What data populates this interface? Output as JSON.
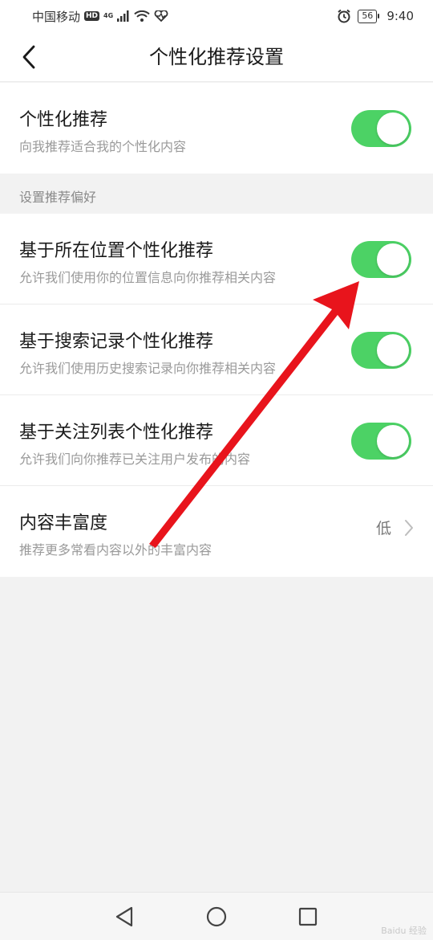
{
  "status_bar": {
    "carrier": "中国移动",
    "hd": "HD",
    "network": "4G",
    "battery": "56",
    "time": "9:40"
  },
  "header": {
    "title": "个性化推荐设置",
    "back_icon": "chevron-left-icon"
  },
  "main_setting": {
    "title": "个性化推荐",
    "desc": "向我推荐适合我的个性化内容",
    "enabled": true
  },
  "preferences": {
    "group_label": "设置推荐偏好",
    "items": [
      {
        "title": "基于所在位置个性化推荐",
        "desc": "允许我们使用你的位置信息向你推荐相关内容",
        "enabled": true
      },
      {
        "title": "基于搜索记录个性化推荐",
        "desc": "允许我们使用历史搜索记录向你推荐相关内容",
        "enabled": true
      },
      {
        "title": "基于关注列表个性化推荐",
        "desc": "允许我们向你推荐已关注用户发布的内容",
        "enabled": true
      }
    ],
    "richness": {
      "title": "内容丰富度",
      "desc": "推荐更多常看内容以外的丰富内容",
      "value": "低"
    }
  },
  "colors": {
    "toggle_on": "#4cd265",
    "annotation_arrow": "#e8141c"
  },
  "watermark": "Baidu 经验"
}
